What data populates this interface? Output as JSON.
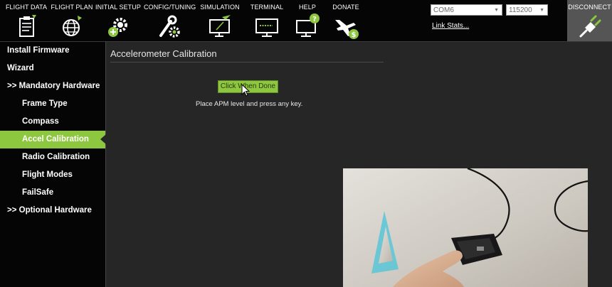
{
  "toolbar": {
    "buttons": [
      {
        "label": "FLIGHT DATA",
        "icon": "clipboard-icon"
      },
      {
        "label": "FLIGHT PLAN",
        "icon": "globe-icon"
      },
      {
        "label": "INITIAL SETUP",
        "icon": "gear-plus-icon"
      },
      {
        "label": "CONFIG/TUNING",
        "icon": "wrench-gear-icon"
      },
      {
        "label": "SIMULATION",
        "icon": "monitor-plane-icon"
      },
      {
        "label": "TERMINAL",
        "icon": "terminal-monitor-icon"
      },
      {
        "label": "HELP",
        "icon": "help-monitor-icon"
      },
      {
        "label": "DONATE",
        "icon": "plane-dollar-icon"
      }
    ],
    "port_select": "COM6",
    "baud_select": "115200",
    "link_stats": "Link Stats...",
    "disconnect_label": "DISCONNECT"
  },
  "sidebar": {
    "items": [
      {
        "label": "Install Firmware"
      },
      {
        "label": "Wizard"
      },
      {
        "label": ">> Mandatory Hardware"
      },
      {
        "label": "Frame Type"
      },
      {
        "label": "Compass"
      },
      {
        "label": "Accel Calibration",
        "active": true
      },
      {
        "label": "Radio Calibration"
      },
      {
        "label": "Flight Modes"
      },
      {
        "label": "FailSafe"
      },
      {
        "label": ">> Optional Hardware"
      }
    ]
  },
  "main": {
    "title": "Accelerometer Calibration",
    "button_label": "Click When Done",
    "instruction": "Place APM level and press any key."
  },
  "colors": {
    "accent_green": "#8dc63f",
    "toolbar_bg": "#050505",
    "content_bg": "#262626"
  }
}
